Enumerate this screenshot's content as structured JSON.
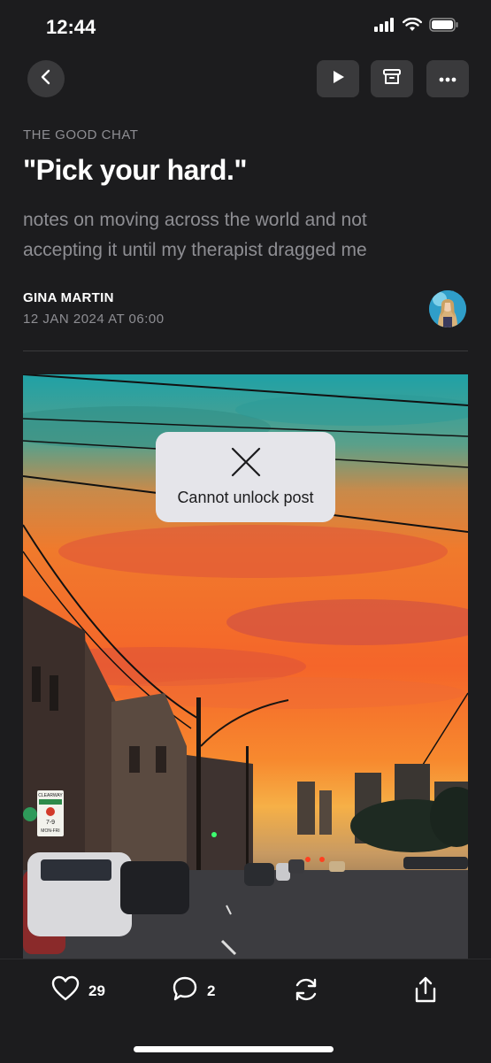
{
  "status": {
    "time": "12:44"
  },
  "post": {
    "publication": "THE GOOD CHAT",
    "title": "\"Pick your hard.\"",
    "subtitle": "notes on moving across the world and not accepting it until my therapist dragged me",
    "author": "GINA MARTIN",
    "date": "12 JAN 2024 AT 06:00"
  },
  "toast": {
    "message": "Cannot unlock post",
    "icon": "close-icon"
  },
  "actions": {
    "likes": "29",
    "comments": "2"
  },
  "sign_texts": {
    "clearway": "CLEARWAY",
    "times": "7-9",
    "days": "MON-FRI"
  },
  "colors": {
    "background": "#1c1c1e",
    "button": "#3a3a3c",
    "muted": "#8e8e93",
    "toast": "#e5e5ea"
  }
}
